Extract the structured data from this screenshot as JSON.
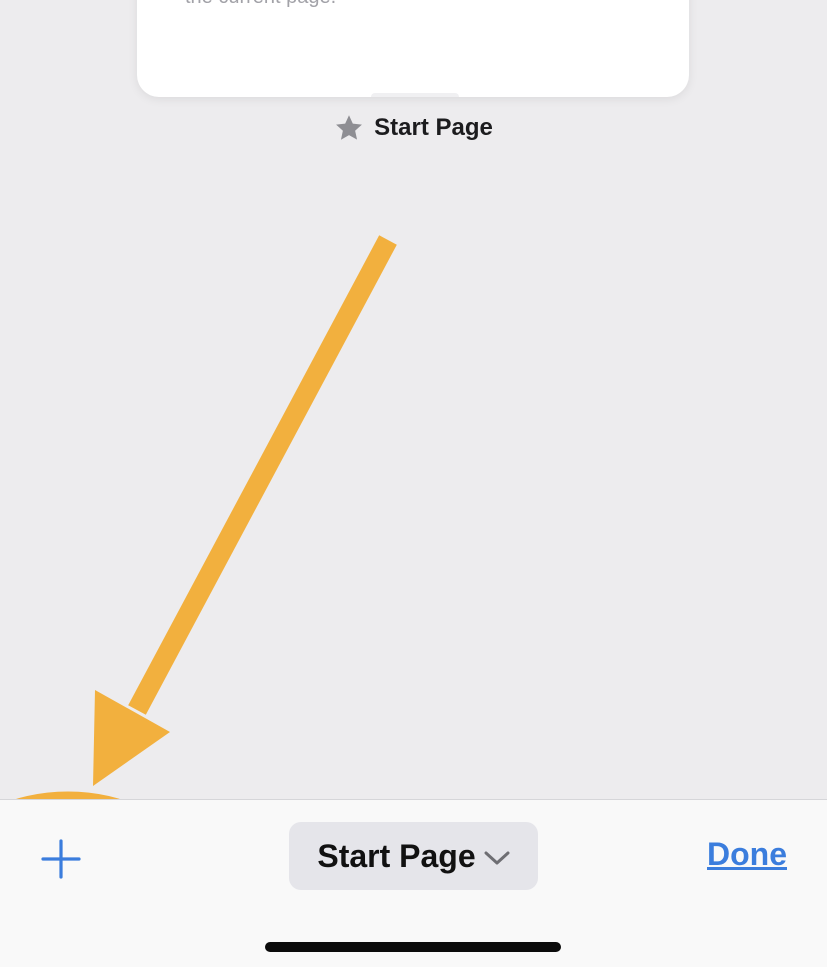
{
  "tab_card": {
    "preview_text": "the current page."
  },
  "tab_title": "Start Page",
  "toolbar": {
    "new_tab_icon": "plus-icon",
    "group_label": "Start Page",
    "group_icon": "chevron-down-icon",
    "done_label": "Done"
  },
  "annotation": {
    "color": "#f2b03e"
  },
  "colors": {
    "background": "#edecee",
    "accent": "#3b7ddd"
  }
}
